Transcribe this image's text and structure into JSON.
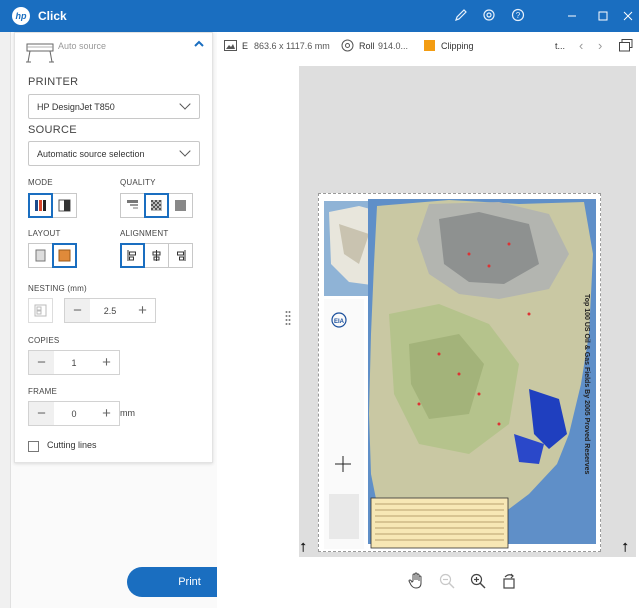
{
  "window": {
    "logo_text": "hp",
    "title": "Click"
  },
  "panel": {
    "auto_source_label": "Auto source",
    "printer_label": "PRINTER",
    "printer_value": "HP DesignJet T850",
    "source_label": "SOURCE",
    "source_value": "Automatic source selection",
    "mode_label": "MODE",
    "quality_label": "QUALITY",
    "layout_label": "LAYOUT",
    "alignment_label": "ALIGNMENT",
    "nesting_label": "NESTING (mm)",
    "nesting_value": "2.5",
    "copies_label": "COPIES",
    "copies_value": "1",
    "frame_label": "FRAME",
    "frame_value": "0",
    "frame_unit": "mm",
    "cutting_lines_label": "Cutting lines",
    "cutting_lines_checked": false
  },
  "print_button": {
    "label": "Print"
  },
  "info_bar": {
    "size_prefix": "E",
    "size_value": "863.6 x 1117.6 mm",
    "roll_label": "Roll",
    "roll_value": "914.0...",
    "clipping_label": "Clipping",
    "clipping_color": "#f39c12",
    "truncated_text": "t..."
  },
  "preview": {
    "map_title": "Top 100 US Oil & Gas Fields By 2005 Proved Reserves",
    "org_label": "EIA"
  },
  "colors": {
    "accent": "#1a6ec0",
    "titlebar": "#1a6ec0"
  }
}
